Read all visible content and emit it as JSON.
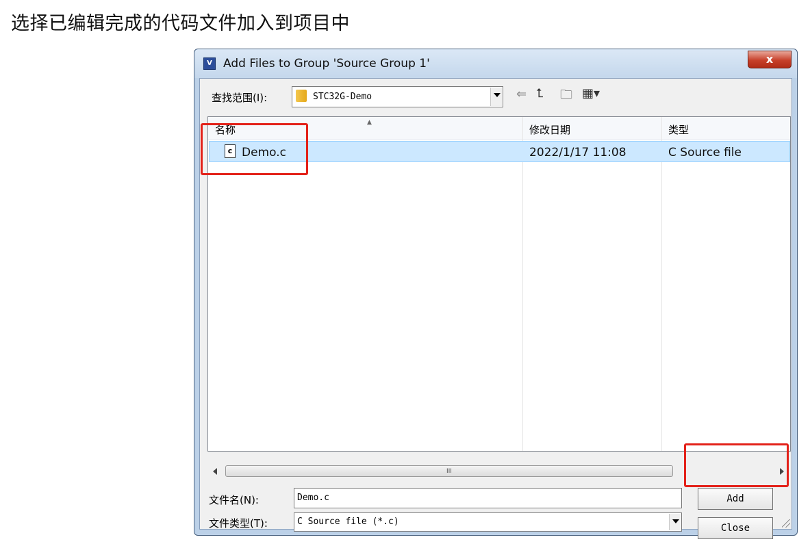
{
  "caption": "选择已编辑完成的代码文件加入到项目中",
  "dialog": {
    "title": "Add Files to Group 'Source Group 1'",
    "close_glyph": "x",
    "app_icon_text": "V"
  },
  "look_in": {
    "label": "查找范围(I):",
    "value": "STC32G-Demo"
  },
  "toolbar": {
    "back_glyph": "⇐",
    "up_glyph": "⮤",
    "new_folder_glyph": "🗀",
    "view_glyph": "▦▾"
  },
  "file_list": {
    "columns": [
      "名称",
      "修改日期",
      "类型"
    ],
    "rows": [
      {
        "name": "Demo.c",
        "modified": "2022/1/17 11:08",
        "type": "C Source file",
        "icon_text": "c"
      }
    ],
    "scroll_grip": "III"
  },
  "file_name": {
    "label": "文件名(N):",
    "value": "Demo.c"
  },
  "file_type": {
    "label": "文件类型(T):",
    "value": "C Source file (*.c)"
  },
  "buttons": {
    "add": "Add",
    "close": "Close"
  },
  "colors": {
    "highlight": "#e32119",
    "selection": "#cce8ff",
    "window_frame": "#bcd1e8"
  }
}
